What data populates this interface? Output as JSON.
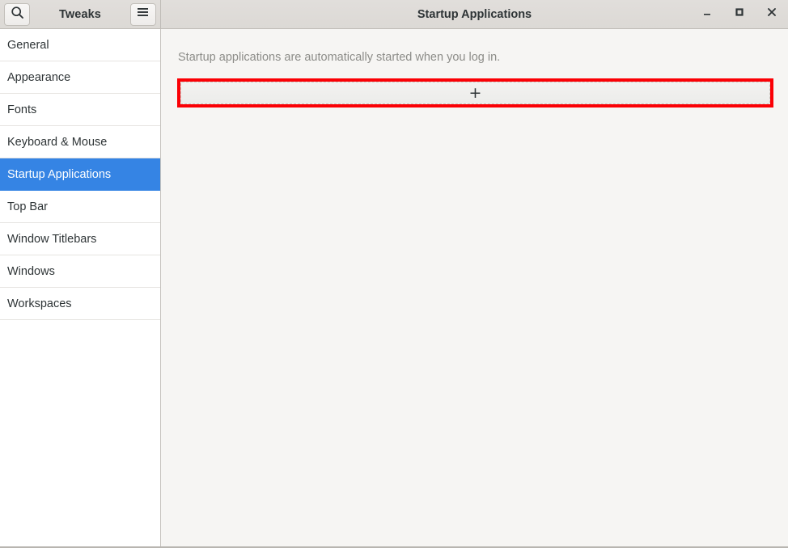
{
  "window": {
    "title": "Startup Applications",
    "app_name": "Tweaks",
    "controls": {
      "minimize": "–",
      "maximize": "□",
      "close": "✕"
    },
    "icons": {
      "search": "search-icon",
      "menu": "hamburger-menu-icon"
    }
  },
  "sidebar": {
    "items": [
      {
        "label": "General",
        "selected": false
      },
      {
        "label": "Appearance",
        "selected": false
      },
      {
        "label": "Fonts",
        "selected": false
      },
      {
        "label": "Keyboard & Mouse",
        "selected": false
      },
      {
        "label": "Startup Applications",
        "selected": true
      },
      {
        "label": "Top Bar",
        "selected": false
      },
      {
        "label": "Window Titlebars",
        "selected": false
      },
      {
        "label": "Windows",
        "selected": false
      },
      {
        "label": "Workspaces",
        "selected": false
      }
    ]
  },
  "main": {
    "description": "Startup applications are automatically started when you log in.",
    "add_button": {
      "glyph": "+",
      "icon_name": "plus-icon"
    }
  },
  "colors": {
    "accent_selected": "#3584e4",
    "highlight_annotation": "#fb0005",
    "headerbar": "#dedbd7",
    "content_bg": "#f6f5f3",
    "sidebar_bg": "#ffffff",
    "text": "#2e3436",
    "muted_text": "#8c8c88"
  }
}
